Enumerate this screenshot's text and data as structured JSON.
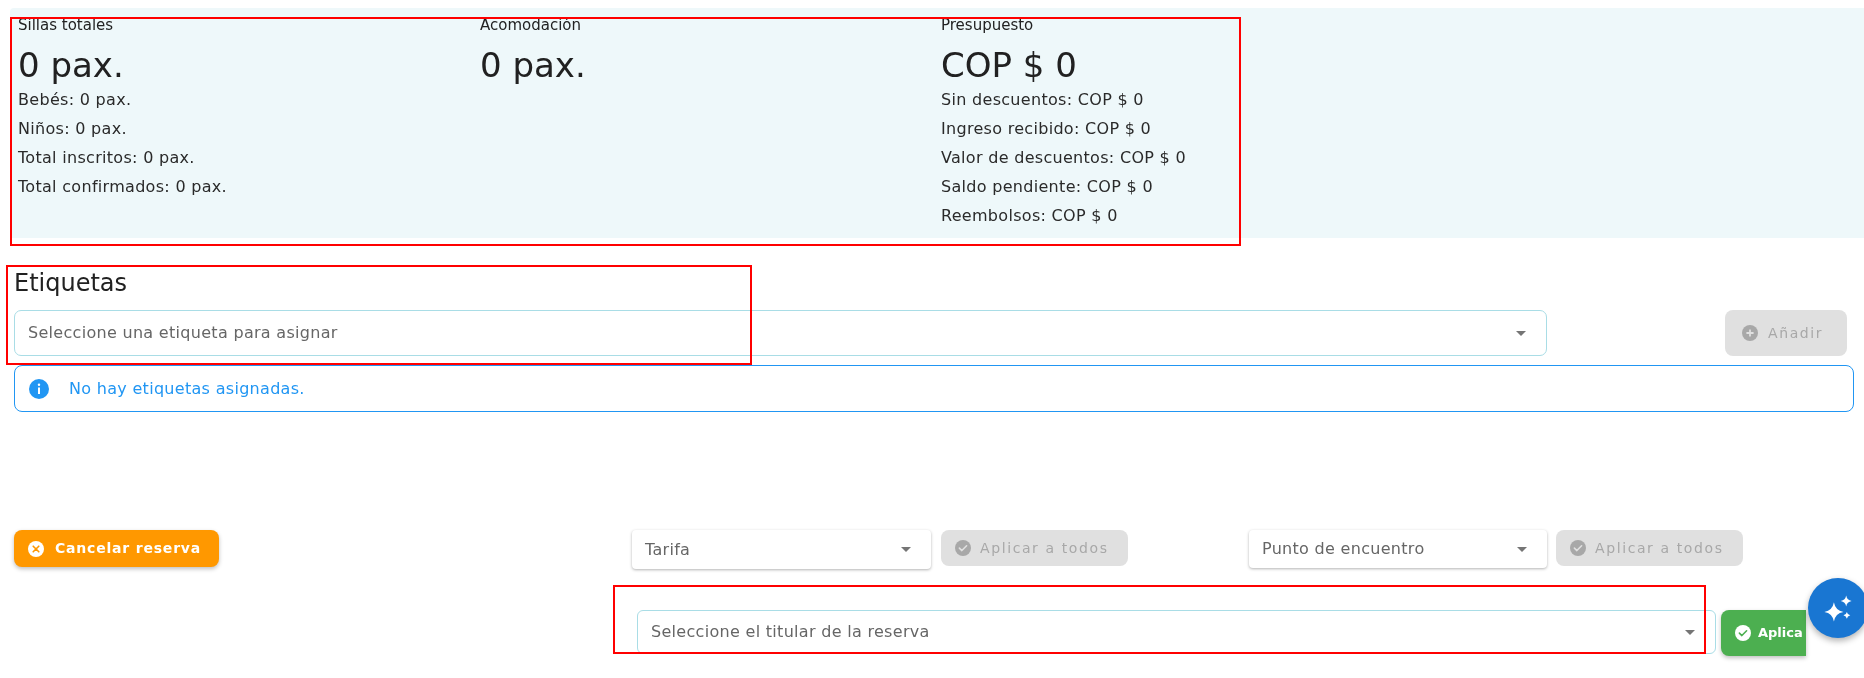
{
  "summary": {
    "highlighted": true,
    "columns": [
      {
        "title": "Sillas totales",
        "value": "0 pax.",
        "details": [
          "Bebés: 0 pax.",
          "Niños: 0 pax.",
          "Total inscritos: 0 pax.",
          "Total confirmados: 0 pax."
        ]
      },
      {
        "title": "Acomodación",
        "value": "0 pax."
      },
      {
        "title": "Presupuesto",
        "value": "COP $ 0",
        "details": [
          "Sin descuentos: COP $ 0",
          "Ingreso recibido: COP $ 0",
          "Valor de descuentos: COP $ 0",
          "Saldo pendiente: COP $ 0",
          "Reembolsos: COP $ 0"
        ]
      }
    ]
  },
  "tags": {
    "highlighted": true,
    "title": "Etiquetas",
    "select": {
      "placeholder": "Seleccione una etiqueta para asignar"
    },
    "add_button": {
      "label": "Añadir",
      "disabled": true
    },
    "alert": {
      "kind": "info",
      "text": "No hay etiquetas asignadas."
    }
  },
  "actions": {
    "cancel_button": {
      "label": "Cancelar reserva",
      "disabled": false
    },
    "fare_select": {
      "placeholder": "Tarifa"
    },
    "fare_apply_button": {
      "label": "Aplicar a todos",
      "disabled": true
    },
    "meeting_point_select": {
      "placeholder": "Punto de encuentro"
    },
    "meeting_point_apply_button": {
      "label": "Aplicar a todos",
      "disabled": true
    }
  },
  "holder": {
    "highlighted": true,
    "select": {
      "placeholder": "Seleccione el titular de la reserva"
    },
    "apply_button": {
      "label": "Aplica",
      "disabled": false
    }
  }
}
